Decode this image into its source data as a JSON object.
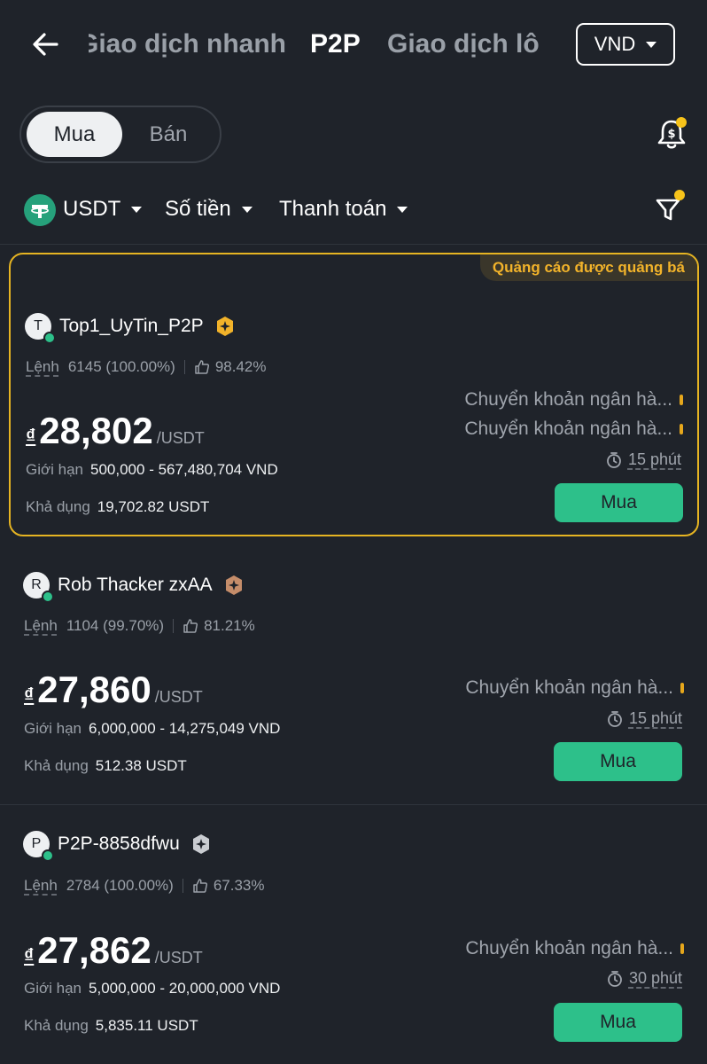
{
  "header": {
    "tabs": [
      "Giao dịch nhanh",
      "P2P",
      "Giao dịch lô"
    ],
    "currency": "VND"
  },
  "toggle": {
    "buy": "Mua",
    "sell": "Bán"
  },
  "filters": {
    "coin": "USDT",
    "amount": "Số tiền",
    "payment": "Thanh toán"
  },
  "colors": {
    "accent_green": "#2dc08a",
    "promo_gold": "#e6b422",
    "background": "#1f232a"
  },
  "listings": [
    {
      "promoted": true,
      "promo_label": "Quảng cáo được quảng bá",
      "avatar": "T",
      "name": "Top1_UyTin_P2P",
      "badge": "gold-merchant-badge-icon",
      "order_label": "Lệnh",
      "orders": "6145 (100.00%)",
      "rating": "98.42%",
      "currency_symbol": "₫",
      "price": "28,802",
      "unit": "/USDT",
      "limit_label": "Giới hạn",
      "limit": "500,000 - 567,480,704 VND",
      "available_label": "Khả dụng",
      "available": "19,702.82 USDT",
      "payments": [
        "Chuyển khoản ngân hà...",
        "Chuyển khoản ngân hà..."
      ],
      "time": "15 phút",
      "button": "Mua"
    },
    {
      "promoted": false,
      "avatar": "R",
      "name": "Rob Thacker zxAA",
      "badge": "bronze-merchant-badge-icon",
      "order_label": "Lệnh",
      "orders": "1104 (99.70%)",
      "rating": "81.21%",
      "currency_symbol": "₫",
      "price": "27,860",
      "unit": "/USDT",
      "limit_label": "Giới hạn",
      "limit": "6,000,000 - 14,275,049 VND",
      "available_label": "Khả dụng",
      "available": "512.38 USDT",
      "payments": [
        "Chuyển khoản ngân hà..."
      ],
      "time": "15 phút",
      "button": "Mua"
    },
    {
      "promoted": false,
      "avatar": "P",
      "name": "P2P-8858dfwu",
      "badge": "silver-merchant-badge-icon",
      "order_label": "Lệnh",
      "orders": "2784 (100.00%)",
      "rating": "67.33%",
      "currency_symbol": "₫",
      "price": "27,862",
      "unit": "/USDT",
      "limit_label": "Giới hạn",
      "limit": "5,000,000 - 20,000,000 VND",
      "available_label": "Khả dụng",
      "available": "5,835.11 USDT",
      "payments": [
        "Chuyển khoản ngân hà..."
      ],
      "time": "30 phút",
      "button": "Mua"
    }
  ]
}
